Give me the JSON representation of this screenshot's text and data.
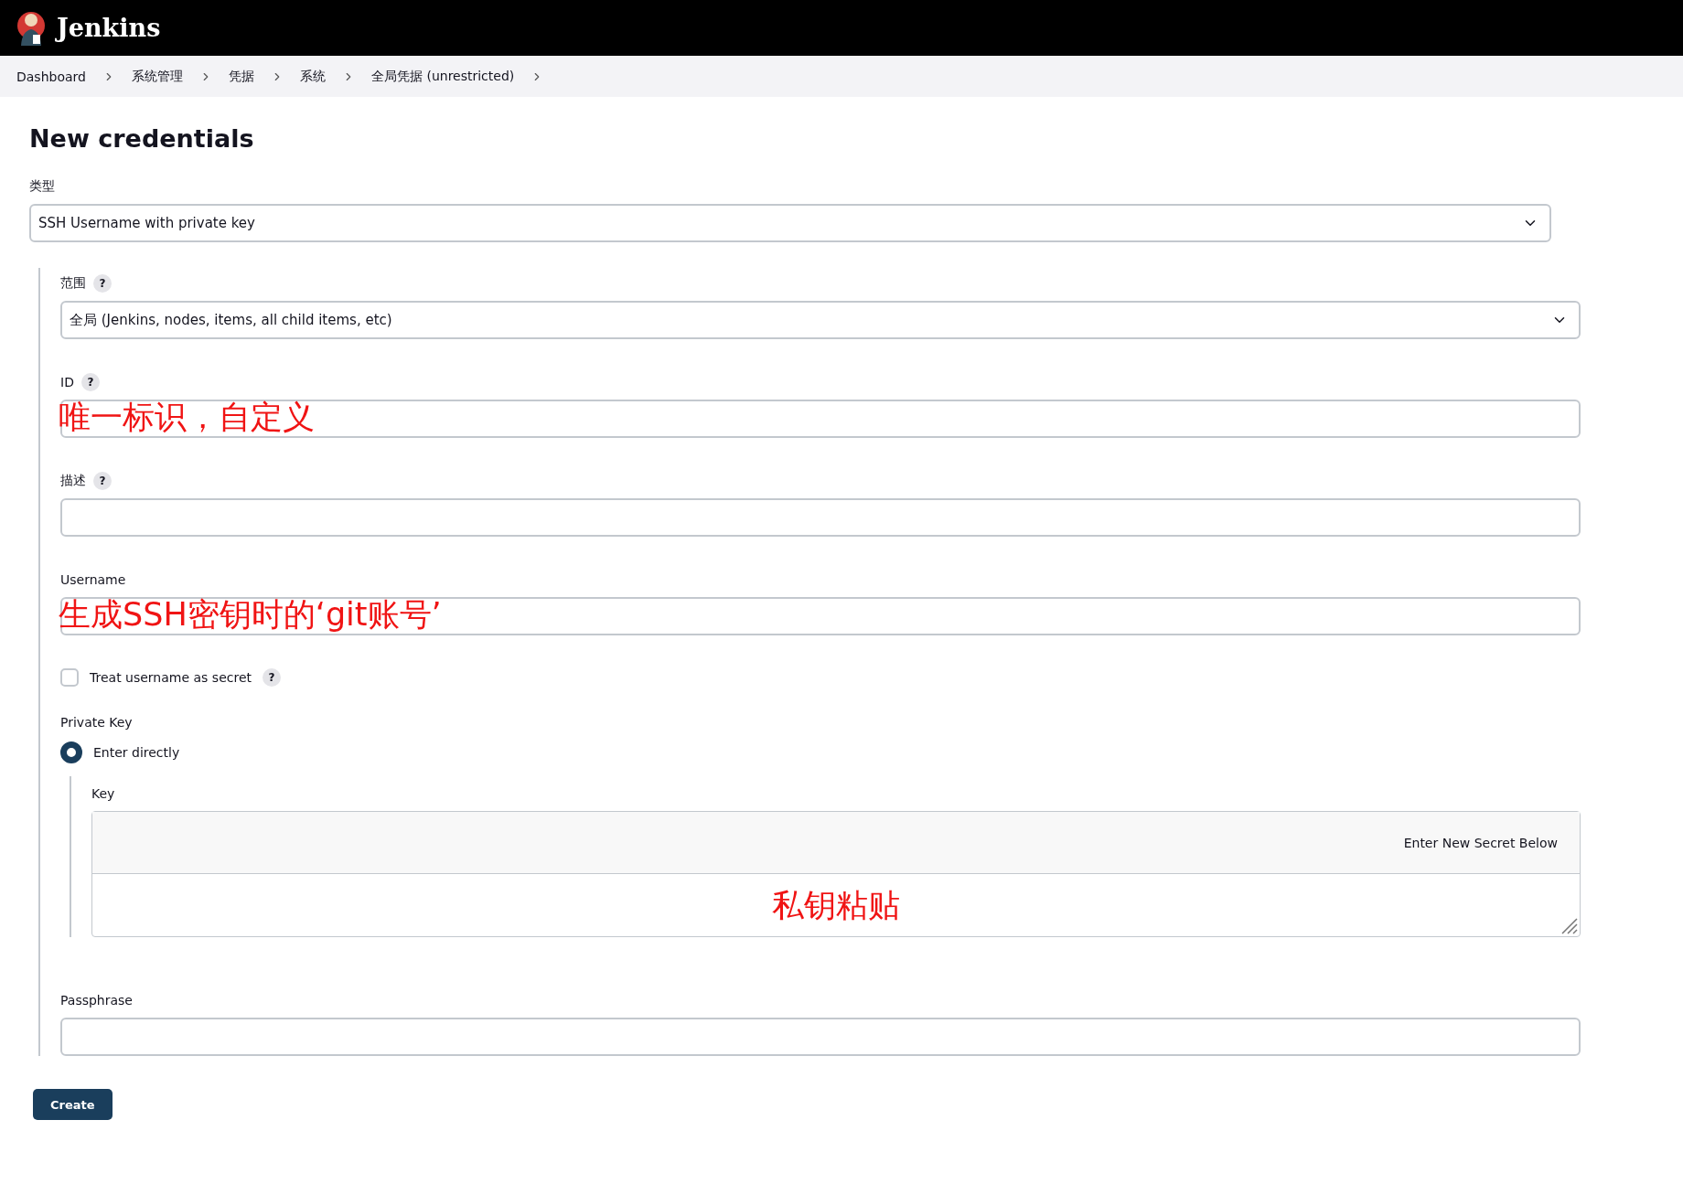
{
  "header": {
    "title": "Jenkins"
  },
  "breadcrumbs": [
    "Dashboard",
    "系统管理",
    "凭据",
    "系统",
    "全局凭据 (unrestricted)"
  ],
  "page_title": "New credentials",
  "type_field": {
    "label": "类型",
    "value": "SSH Username with private key"
  },
  "fields": [
    {
      "kind": "select",
      "label": "范围",
      "help": "?",
      "value": "全局 (Jenkins, nodes, items, all child items, etc)"
    },
    {
      "kind": "text",
      "label": "ID",
      "help": "?",
      "annotation": "唯一标识，自定义"
    },
    {
      "kind": "text",
      "label": "描述",
      "help": "?"
    },
    {
      "kind": "text",
      "label": "Username",
      "annotation": "生成SSH密钥时的‘git账号’"
    },
    {
      "kind": "checkbox",
      "label": "Treat username as secret",
      "help": "?",
      "checked": false
    },
    {
      "kind": "heading",
      "label": "Private Key"
    },
    {
      "kind": "radio",
      "label": "Enter directly",
      "selected": true,
      "key": {
        "label": "Key",
        "notice": "Enter New Secret Below",
        "annotation": "私钥粘贴"
      }
    },
    {
      "kind": "text",
      "label": "Passphrase"
    }
  ],
  "submit": "Create"
}
